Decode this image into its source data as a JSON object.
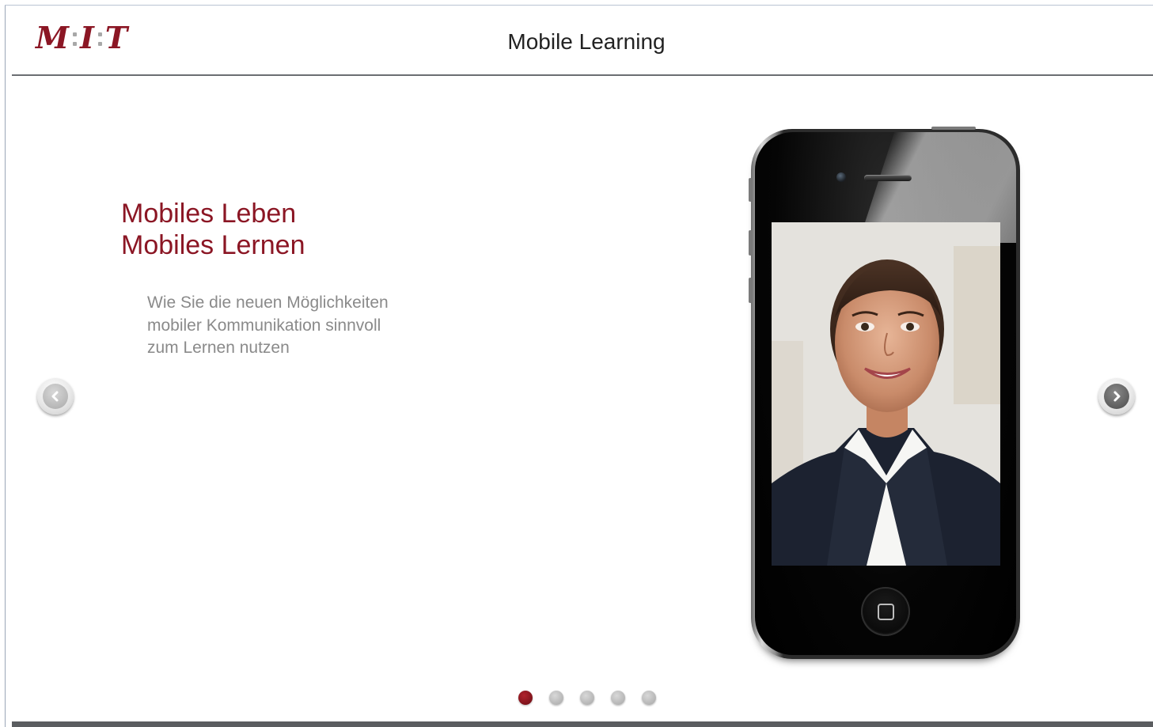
{
  "header": {
    "logo_text": [
      "M",
      "I",
      "T"
    ],
    "title": "Mobile Learning"
  },
  "slide": {
    "headline_line1": "Mobiles Leben",
    "headline_line2": "Mobiles Lernen",
    "subtext_line1": "Wie Sie die neuen Möglichkeiten",
    "subtext_line2": "mobiler Kommunikation sinnvoll",
    "subtext_line3": "zum Lernen nutzen"
  },
  "carousel": {
    "slide_count": 5,
    "active_index": 0
  },
  "colors": {
    "brand": "#8b1624",
    "subtext": "#8a8a8a",
    "rule": "#6b6e72"
  },
  "icons": {
    "prev": "chevron-left-icon",
    "next": "chevron-right-icon"
  }
}
